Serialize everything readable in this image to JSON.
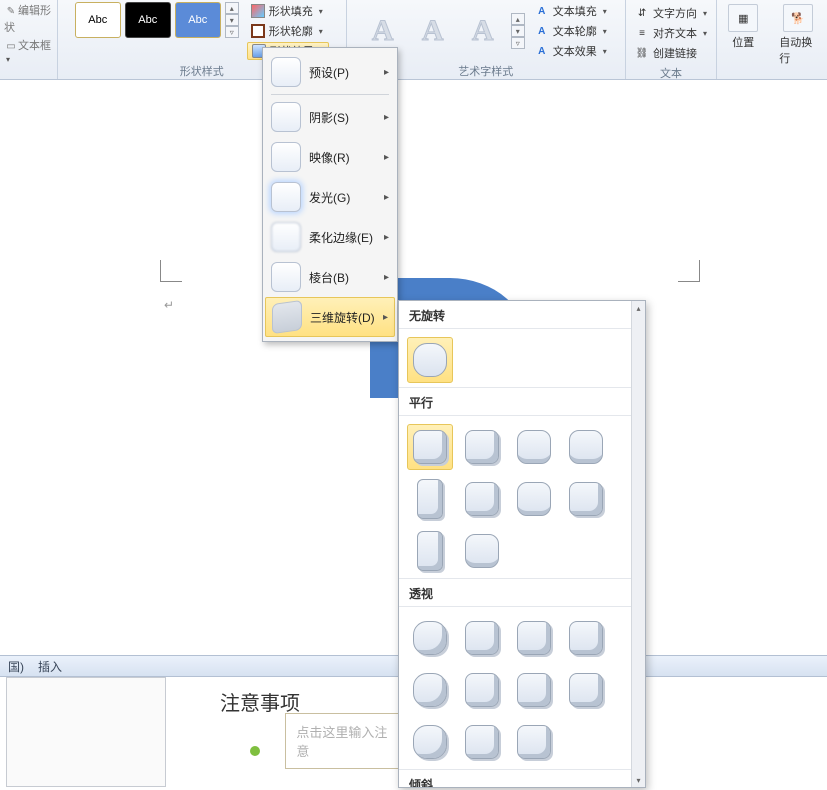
{
  "ribbon": {
    "left_vert": {
      "edit_shape": "编辑形状",
      "textbox": "文本框"
    },
    "shape_styles_label": "形状样式",
    "abc": "Abc",
    "shape_fill": "形状填充",
    "shape_outline": "形状轮廓",
    "shape_effects": "形状效果",
    "wordart_label": "艺术字样式",
    "text_fill": "文本填充",
    "text_outline": "文本轮廓",
    "text_effects": "文本效果",
    "text_group_label": "文本",
    "text_direction": "文字方向",
    "align_text": "对齐文本",
    "create_link": "创建链接",
    "position": "位置",
    "wrap": "自动换行"
  },
  "effects_menu": {
    "preset": "预设(P)",
    "shadow": "阴影(S)",
    "reflection": "映像(R)",
    "glow": "发光(G)",
    "soft_edges": "柔化边缘(E)",
    "bevel": "棱台(B)",
    "rotation3d": "三维旋转(D)"
  },
  "rotation_flyout": {
    "no_rotation": "无旋转",
    "parallel": "平行",
    "perspective": "透视",
    "oblique": "倾斜"
  },
  "status": {
    "tab1": "国)",
    "tab2": "插入"
  },
  "notes": {
    "title": "注意事项",
    "placeholder": "点击这里输入注意"
  }
}
